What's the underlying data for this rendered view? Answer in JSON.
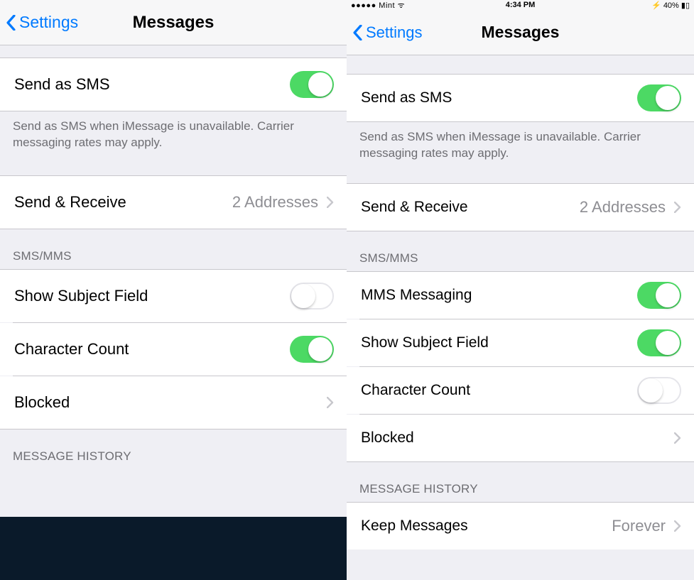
{
  "left": {
    "nav": {
      "back": "Settings",
      "title": "Messages"
    },
    "group1": {
      "send_as_sms": "Send as SMS",
      "footer": "Send as SMS when iMessage is unavailable. Carrier messaging rates may apply."
    },
    "group2": {
      "send_receive": "Send & Receive",
      "send_receive_value": "2 Addresses"
    },
    "sms_header": "SMS/MMS",
    "sms_group": {
      "show_subject": "Show Subject Field",
      "char_count": "Character Count",
      "blocked": "Blocked"
    },
    "history_header": "MESSAGE HISTORY"
  },
  "right": {
    "nav": {
      "back": "Settings",
      "title": "Messages"
    },
    "group1": {
      "send_as_sms": "Send as SMS",
      "footer": "Send as SMS when iMessage is unavailable. Carrier messaging rates may apply."
    },
    "group2": {
      "send_receive": "Send & Receive",
      "send_receive_value": "2 Addresses"
    },
    "sms_header": "SMS/MMS",
    "sms_group": {
      "mms": "MMS Messaging",
      "show_subject": "Show Subject Field",
      "char_count": "Character Count",
      "blocked": "Blocked"
    },
    "history_header": "MESSAGE HISTORY",
    "history_group": {
      "keep": "Keep Messages",
      "keep_value": "Forever"
    }
  }
}
